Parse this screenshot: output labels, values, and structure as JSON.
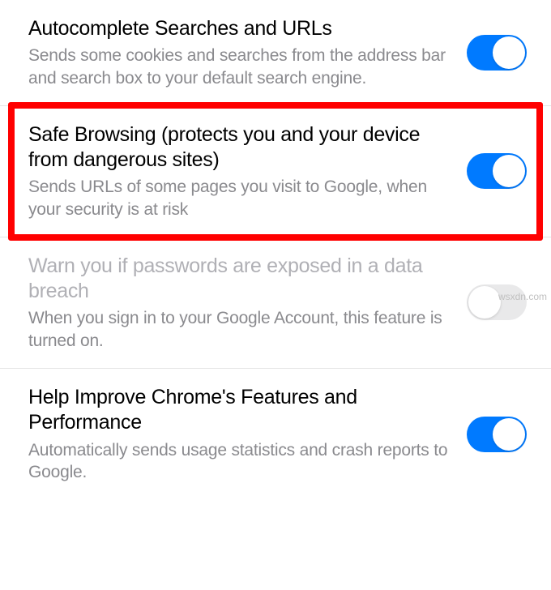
{
  "settings": [
    {
      "title": "Autocomplete Searches and URLs",
      "description": "Sends some cookies and searches from the address bar and search box to your default search engine.",
      "enabled": true,
      "disabled_state": false,
      "highlighted": false
    },
    {
      "title": "Safe Browsing (protects you and your device from dangerous sites)",
      "description": "Sends URLs of some pages you visit to Google, when your security is at risk",
      "enabled": true,
      "disabled_state": false,
      "highlighted": true
    },
    {
      "title": "Warn you if passwords are exposed in a data breach",
      "description": "When you sign in to your Google Account, this feature is turned on.",
      "enabled": false,
      "disabled_state": true,
      "highlighted": false
    },
    {
      "title": "Help Improve Chrome's Features and Performance",
      "description": "Automatically sends usage statistics and crash reports to Google.",
      "enabled": true,
      "disabled_state": false,
      "highlighted": false
    }
  ],
  "watermark": "wsxdn.com"
}
